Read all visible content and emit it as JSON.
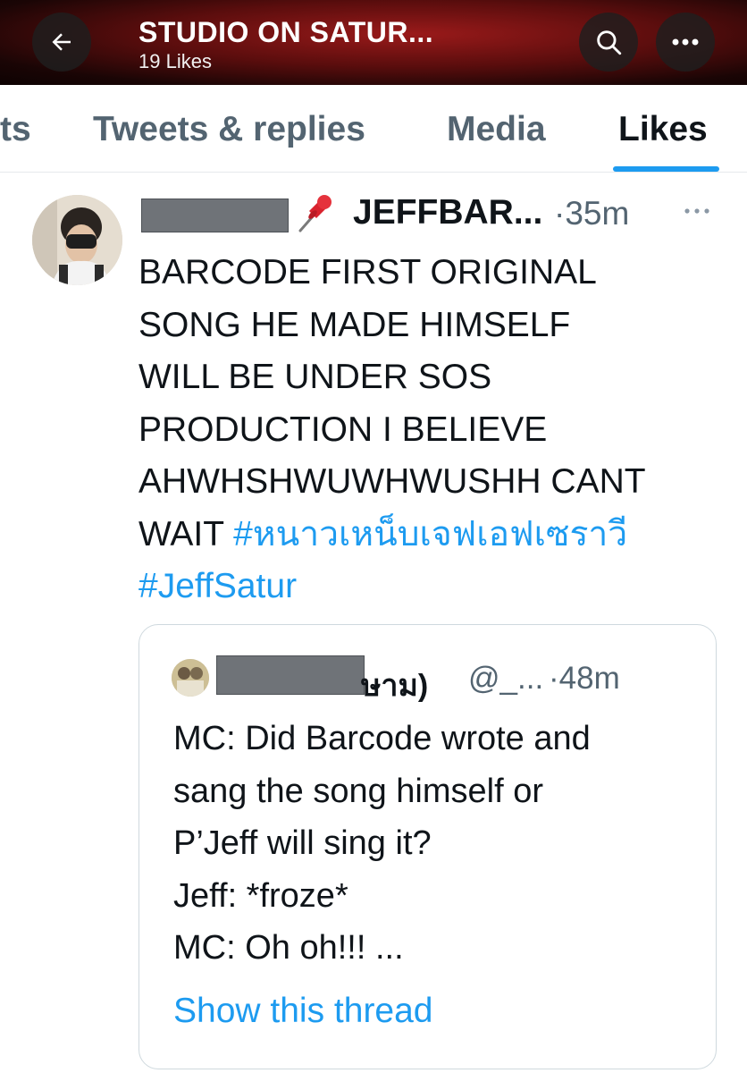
{
  "header": {
    "title": "STUDIO ON SATUR...",
    "subtitle": "19 Likes",
    "back_icon": "arrow-left-icon",
    "search_icon": "search-icon",
    "more_icon": "ellipsis-icon"
  },
  "tabs": [
    {
      "label": "ts"
    },
    {
      "label": "Tweets & replies"
    },
    {
      "label": "Media"
    },
    {
      "label": "Likes",
      "active": true
    }
  ],
  "tweet": {
    "author": "JEFFBAR...",
    "time": "·35m",
    "lines": [
      "BARCODE FIRST ORIGINAL",
      "SONG HE MADE HIMSELF",
      "WILL BE UNDER SOS",
      "PRODUCTION I BELIEVE",
      "AHWHSHWUWHWUSHH CANT"
    ],
    "last_line_prefix": "WAIT ",
    "hashtags": [
      "#หนาวเหน็บเจฟเอฟเซราวี",
      "#JeffSatur"
    ]
  },
  "quote": {
    "name_fragment": "ษาม)",
    "handle": "@_...",
    "time": "·48m",
    "lines": [
      "MC: Did Barcode wrote and",
      "sang the song himself or",
      "P’Jeff will sing it?",
      "Jeff: *froze*",
      "MC: Oh oh!!! ..."
    ],
    "show_thread": "Show this thread"
  },
  "colors": {
    "accent": "#1d9bf0",
    "text": "#0f1419",
    "muted": "#536471",
    "header_bg": "#5a0d0d"
  }
}
